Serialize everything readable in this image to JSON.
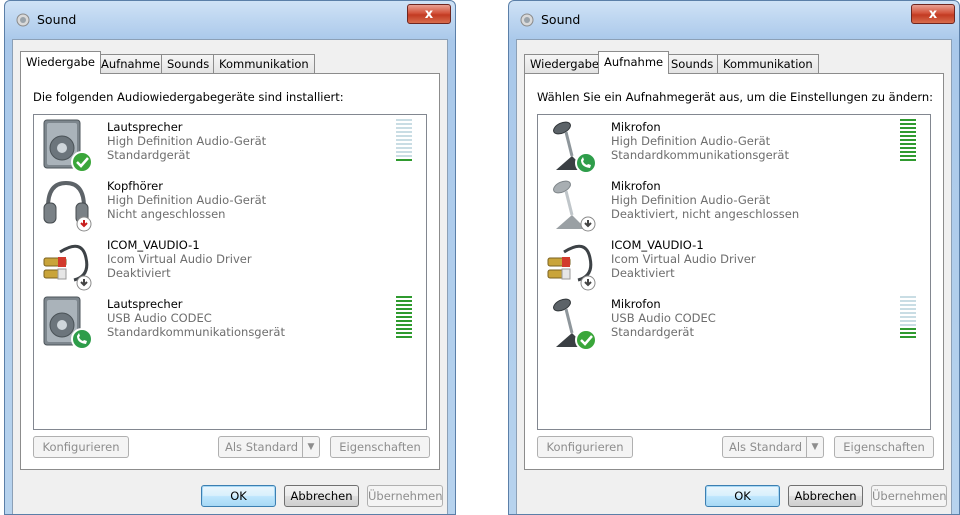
{
  "windows": [
    {
      "title": "Sound",
      "close_label": "x",
      "tabs": [
        "Wiedergabe",
        "Aufnahme",
        "Sounds",
        "Kommunikation"
      ],
      "active_tab": 0,
      "instruction": "Die folgenden Audiowiedergabegeräte sind installiert:",
      "devices": [
        {
          "name": "Lautsprecher",
          "driver": "High Definition Audio-Gerät",
          "status": "Standardgerät",
          "icon": "speaker-icon",
          "badge": "default-check-badge",
          "meter_level": 0.05
        },
        {
          "name": "Kopfhörer",
          "driver": "High Definition Audio-Gerät",
          "status": "Nicht angeschlossen",
          "icon": "headphones-icon",
          "badge": "not-connected-badge"
        },
        {
          "name": "ICOM_VAUDIO-1",
          "driver": "Icom Virtual Audio Driver",
          "status": "Deaktiviert",
          "icon": "cable-icon",
          "badge": "disabled-badge"
        },
        {
          "name": "Lautsprecher",
          "driver": "USB Audio CODEC",
          "status": "Standardkommunikationsgerät",
          "icon": "speaker-icon",
          "badge": "communication-phone-badge",
          "meter_level": 1.0
        }
      ],
      "buttons": {
        "configure": "Konfigurieren",
        "set_default": "Als Standard",
        "properties": "Eigenschaften",
        "ok": "OK",
        "cancel": "Abbrechen",
        "apply": "Übernehmen"
      }
    },
    {
      "title": "Sound",
      "close_label": "x",
      "tabs": [
        "Wiedergabe",
        "Aufnahme",
        "Sounds",
        "Kommunikation"
      ],
      "active_tab": 1,
      "instruction": "Wählen Sie ein Aufnahmegerät aus, um die Einstellungen zu ändern:",
      "devices": [
        {
          "name": "Mikrofon",
          "driver": "High Definition Audio-Gerät",
          "status": "Standardkommunikationsgerät",
          "icon": "microphone-icon",
          "badge": "communication-phone-badge",
          "meter_level": 1.0
        },
        {
          "name": "Mikrofon",
          "driver": "High Definition Audio-Gerät",
          "status": "Deaktiviert, nicht angeschlossen",
          "icon": "microphone-icon",
          "badge": "disabled-badge"
        },
        {
          "name": "ICOM_VAUDIO-1",
          "driver": "Icom Virtual Audio Driver",
          "status": "Deaktiviert",
          "icon": "cable-icon",
          "badge": "disabled-badge"
        },
        {
          "name": "Mikrofon",
          "driver": "USB Audio CODEC",
          "status": "Standardgerät",
          "icon": "microphone-icon",
          "badge": "default-check-badge",
          "meter_level": 0.3
        }
      ],
      "buttons": {
        "configure": "Konfigurieren",
        "set_default": "Als Standard",
        "properties": "Eigenschaften",
        "ok": "OK",
        "cancel": "Abbrechen",
        "apply": "Übernehmen"
      }
    }
  ],
  "colors": {
    "meter_on": "#2f9a2f",
    "meter_off": "#c9dde4",
    "check_badge": "#3aa63a",
    "phone_badge": "#2e9d4a",
    "warning_badge": "#c81e1e"
  }
}
